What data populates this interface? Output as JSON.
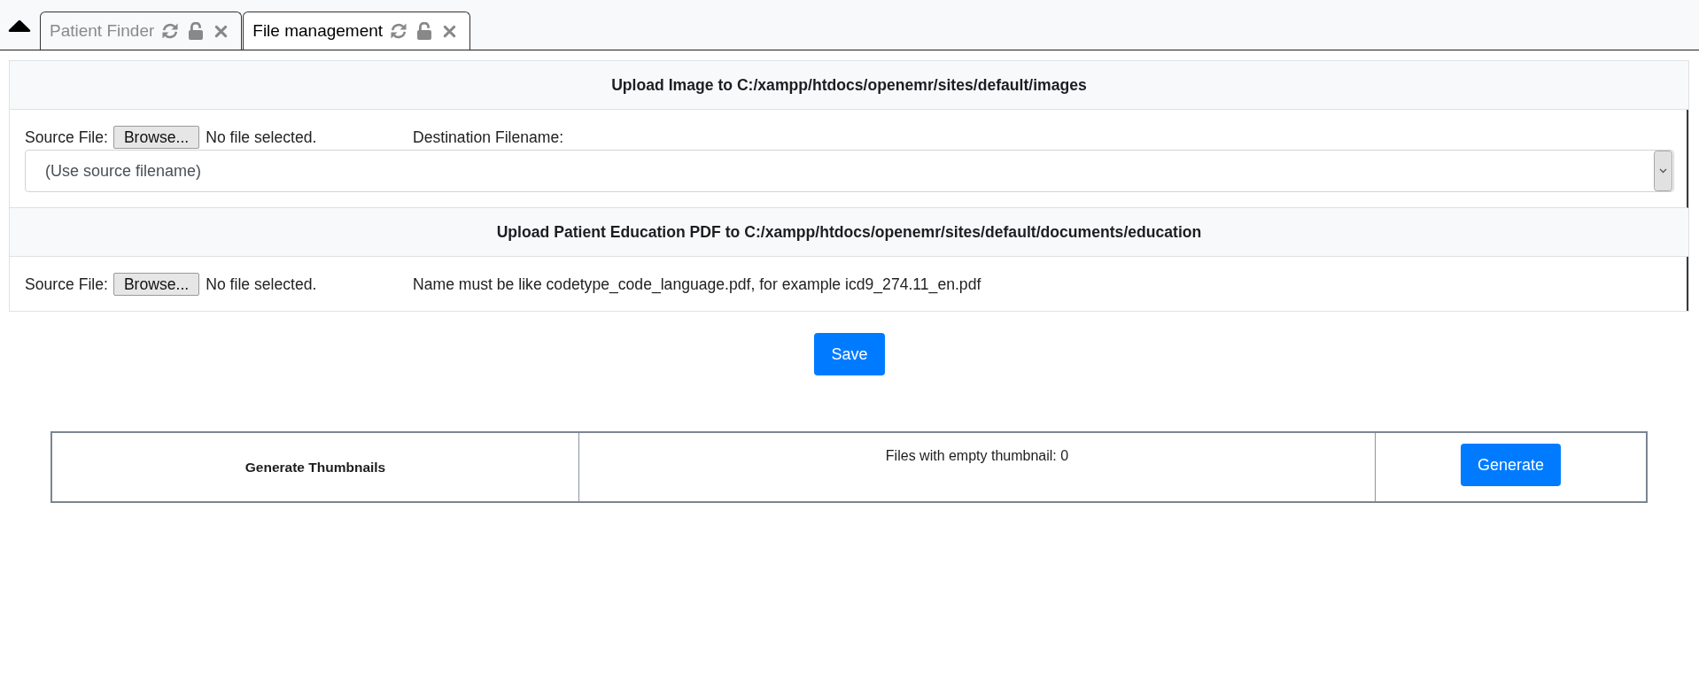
{
  "tab_bar": {
    "tabs": [
      {
        "label": "Patient Finder",
        "selected": false
      },
      {
        "label": "File management",
        "selected": true
      }
    ]
  },
  "image_upload": {
    "title": "Upload Image to C:/xampp/htdocs/openemr/sites/default/images",
    "source_label": "Source File:",
    "browse_button": "Browse...",
    "file_status": "No file selected.",
    "destination_label": "Destination Filename:",
    "destination_select": "(Use source filename)"
  },
  "education_upload": {
    "title": "Upload Patient Education PDF to C:/xampp/htdocs/openemr/sites/default/documents/education",
    "source_label": "Source File:",
    "browse_button": "Browse...",
    "file_status": "No file selected.",
    "hint": "Name must be like codetype_code_language.pdf, for example icd9_274.11_en.pdf"
  },
  "save_button": "Save",
  "thumbnails": {
    "label": "Generate Thumbnails",
    "status": "Files with empty thumbnail: 0",
    "generate_button": "Generate"
  }
}
